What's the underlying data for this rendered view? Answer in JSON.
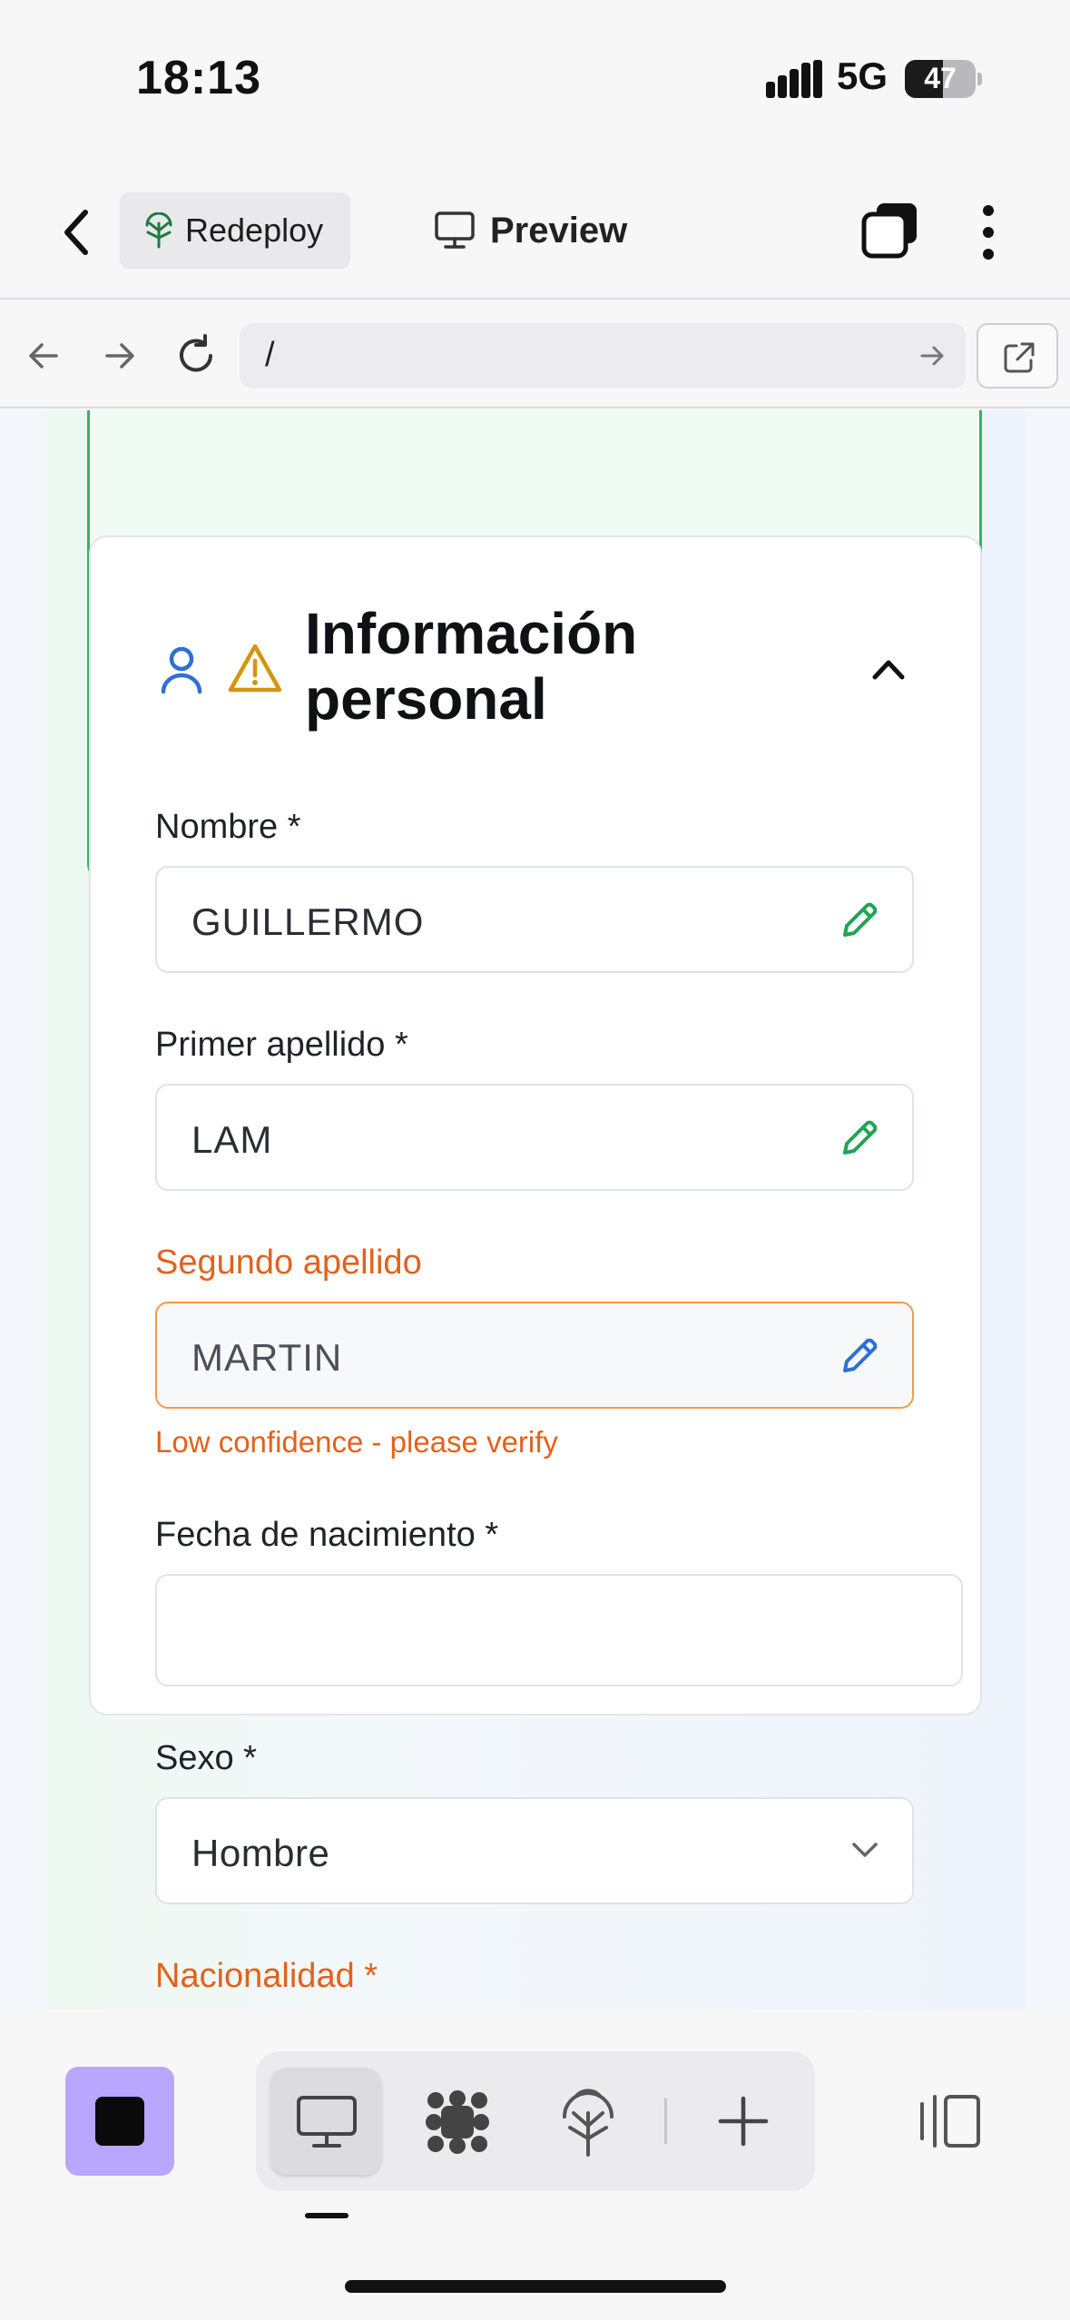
{
  "status_bar": {
    "time": "18:13",
    "network": "5G",
    "battery": "47"
  },
  "app_bar": {
    "redeploy_label": "Redeploy",
    "preview_label": "Preview"
  },
  "browser": {
    "url_path": "/"
  },
  "section": {
    "title": "Información personal",
    "icons": [
      "user-icon",
      "warning-icon",
      "chevron-up-icon"
    ]
  },
  "form": {
    "nombre": {
      "label": "Nombre *",
      "value": "GUILLERMO"
    },
    "primer_apellido": {
      "label": "Primer apellido *",
      "value": "LAM"
    },
    "segundo_apellido": {
      "label": "Segundo apellido",
      "value": "MARTIN",
      "hint": "Low confidence - please verify"
    },
    "fecha_nacimiento": {
      "label": "Fecha de nacimiento *",
      "value": ""
    },
    "sexo": {
      "label": "Sexo *",
      "value": "Hombre"
    },
    "nacionalidad": {
      "label": "Nacionalidad *"
    }
  },
  "colors": {
    "accent_green": "#22a455",
    "warning_orange": "#e2621d",
    "user_blue": "#2f6fd6",
    "stop_button": "#b9a6ff"
  }
}
